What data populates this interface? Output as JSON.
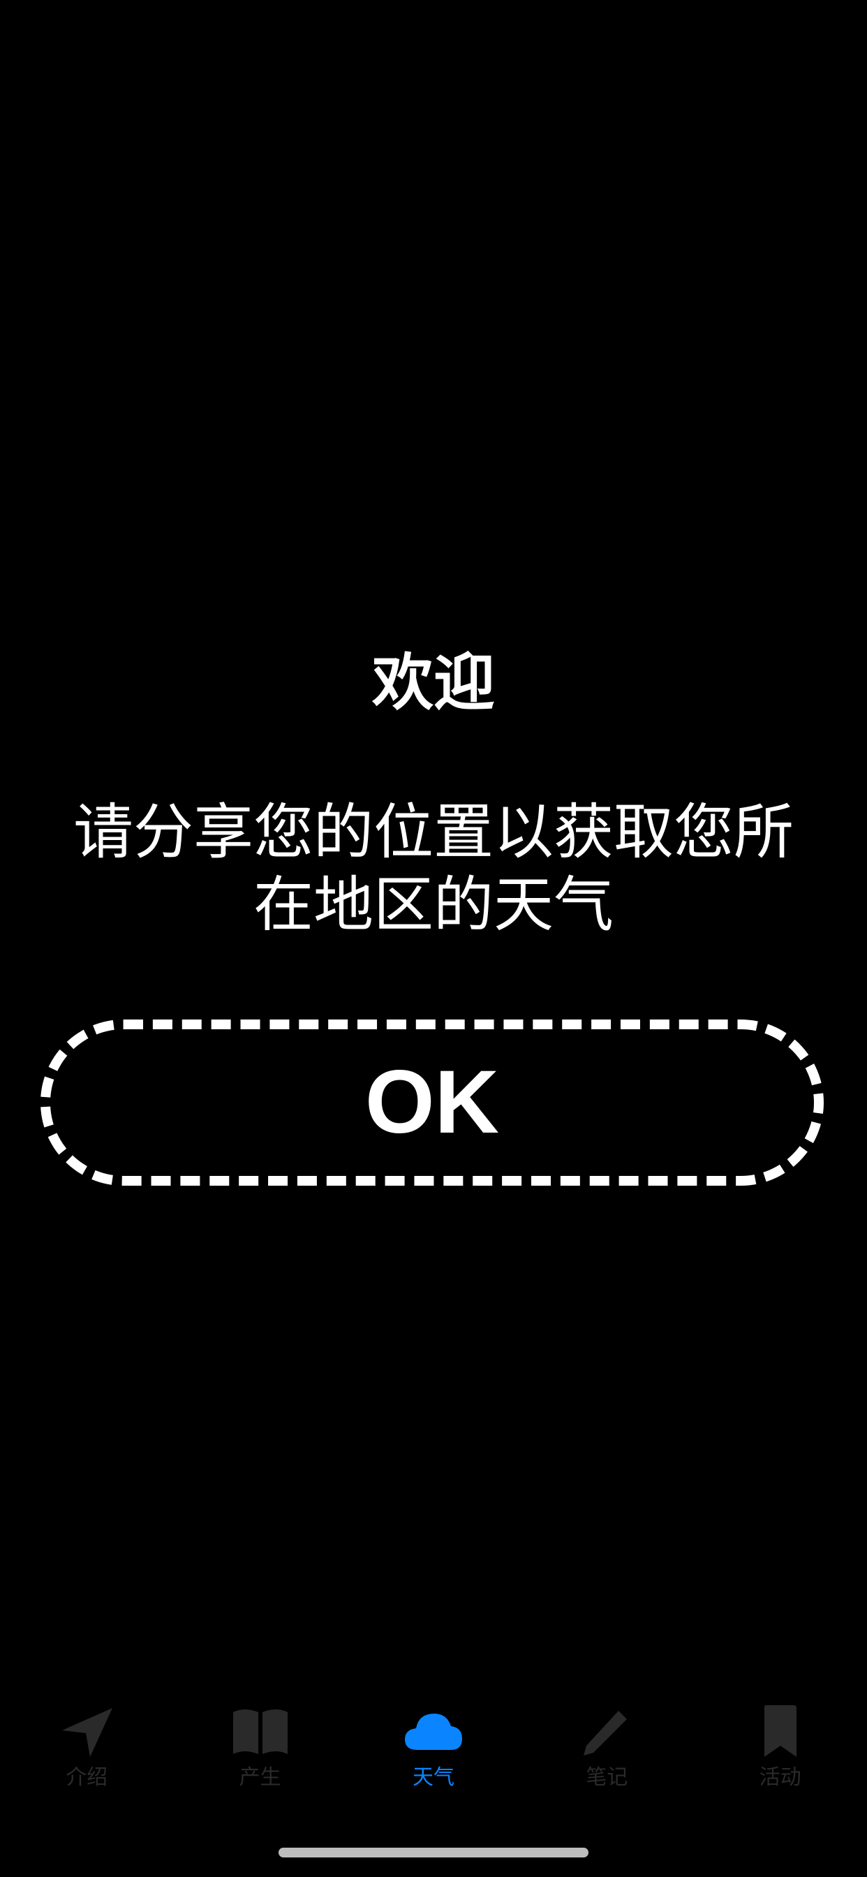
{
  "welcome": {
    "title": "欢迎",
    "message": "请分享您的位置以获取您所在地区的天气"
  },
  "ok_button": {
    "label": "OK"
  },
  "tab_bar": {
    "tabs": [
      {
        "label": "介绍",
        "icon": "location-arrow-icon",
        "active": false
      },
      {
        "label": "产生",
        "icon": "book-icon",
        "active": false
      },
      {
        "label": "天气",
        "icon": "cloud-icon",
        "active": true
      },
      {
        "label": "笔记",
        "icon": "pencil-icon",
        "active": false
      },
      {
        "label": "活动",
        "icon": "bookmark-icon",
        "active": false
      }
    ]
  },
  "colors": {
    "background": "#000000",
    "text": "#ffffff",
    "accent": "#0a84ff",
    "inactive_tab": "#2a2a2a"
  }
}
